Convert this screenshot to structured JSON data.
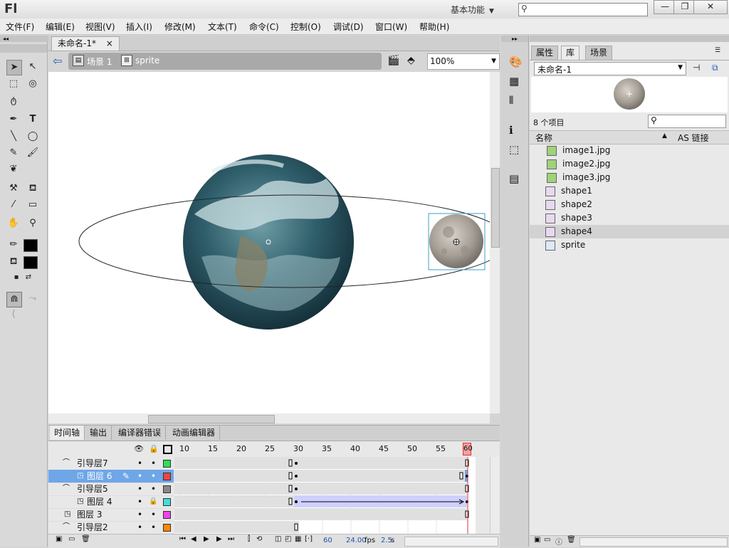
{
  "app": {
    "logo": "Fl",
    "workspace": "基本功能",
    "window_buttons": {
      "minimize": "—",
      "restore": "❐",
      "close": "✕"
    }
  },
  "menu": [
    "文件(F)",
    "编辑(E)",
    "视图(V)",
    "插入(I)",
    "修改(M)",
    "文本(T)",
    "命令(C)",
    "控制(O)",
    "调试(D)",
    "窗口(W)",
    "帮助(H)"
  ],
  "document": {
    "tab_label": "未命名-1*",
    "tab_close": "×",
    "breadcrumb_scene": "场景 1",
    "breadcrumb_symbol": "sprite",
    "zoom": "100%"
  },
  "timeline": {
    "tabs": [
      "时间轴",
      "输出",
      "编译器错误",
      "动画编辑器"
    ],
    "ruler": [
      "10",
      "15",
      "20",
      "25",
      "30",
      "35",
      "40",
      "45",
      "50",
      "55",
      "60"
    ],
    "layers": [
      {
        "name": "引导层7",
        "color": "#33dd55",
        "locked": false
      },
      {
        "name": "图层 6",
        "color": "#ee4444",
        "locked": false
      },
      {
        "name": "引导层5",
        "color": "#888888",
        "locked": false
      },
      {
        "name": "图层 4",
        "color": "#44dddd",
        "locked": true
      },
      {
        "name": "图层 3",
        "color": "#ee44ee",
        "locked": false
      },
      {
        "name": "引导层2",
        "color": "#ff8800",
        "locked": false
      }
    ],
    "status": {
      "frame": "60",
      "fps": "24.00",
      "fps_unit": "fps",
      "time": "2.5",
      "time_unit": "s"
    }
  },
  "library": {
    "tabs": [
      "属性",
      "库",
      "场景"
    ],
    "doc_select": "未命名-1",
    "item_count": "8 个项目",
    "col_name": "名称",
    "col_link": "AS 链接",
    "items": [
      {
        "name": "image1.jpg",
        "kind": "bitmap"
      },
      {
        "name": "image2.jpg",
        "kind": "bitmap"
      },
      {
        "name": "image3.jpg",
        "kind": "bitmap"
      },
      {
        "name": "shape1",
        "kind": "graphic"
      },
      {
        "name": "shape2",
        "kind": "graphic"
      },
      {
        "name": "shape3",
        "kind": "graphic"
      },
      {
        "name": "shape4",
        "kind": "graphic"
      },
      {
        "name": "sprite",
        "kind": "movieclip"
      }
    ]
  }
}
